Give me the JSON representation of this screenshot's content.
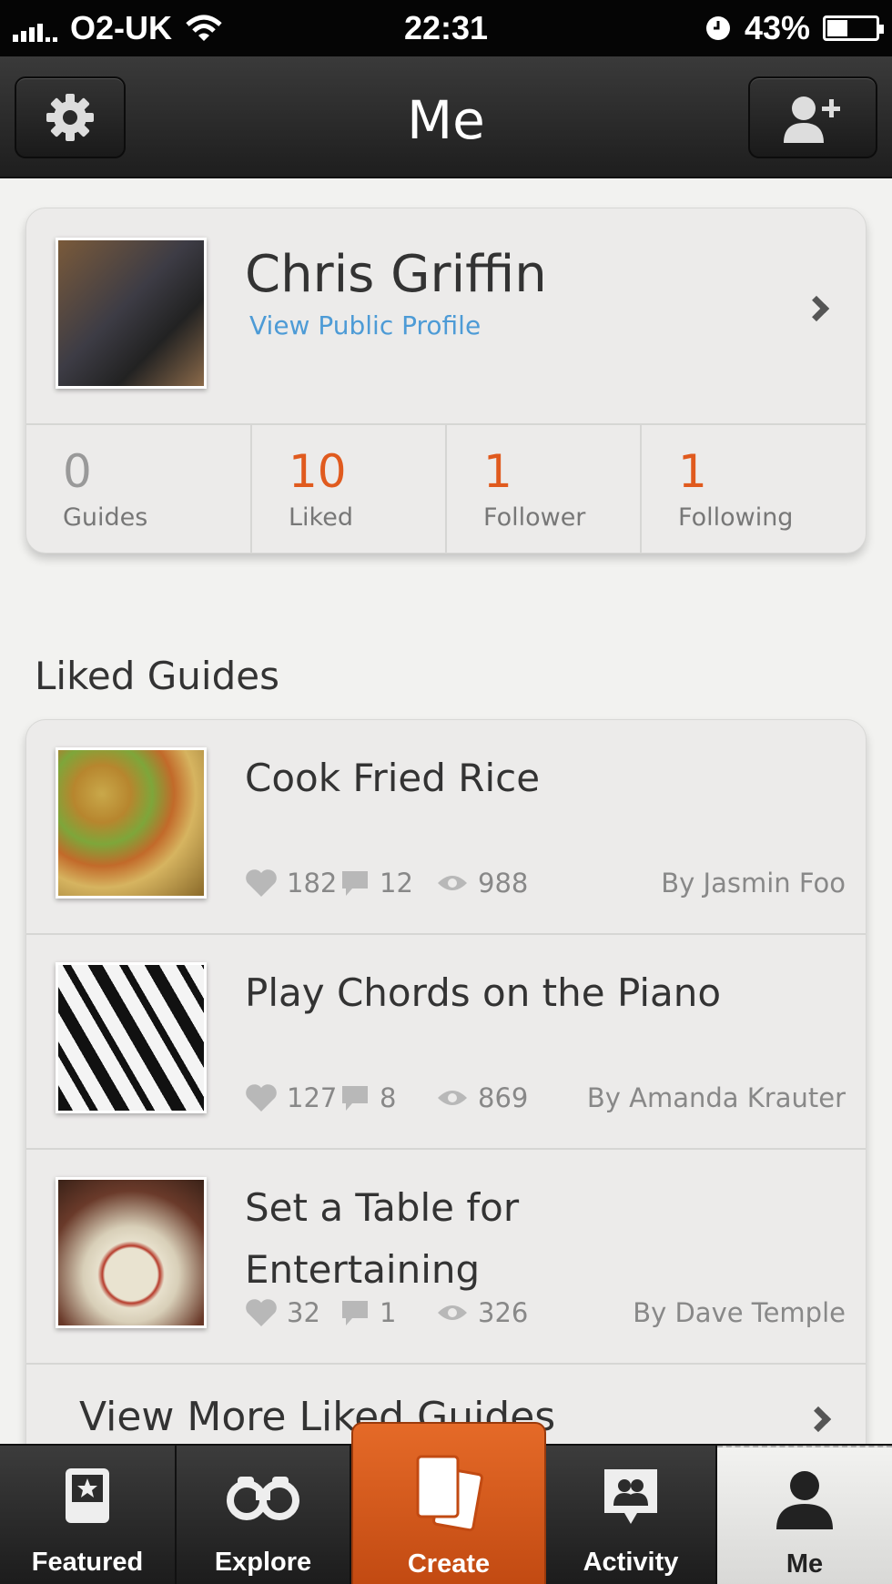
{
  "status_bar": {
    "carrier": "O2-UK",
    "time": "22:31",
    "battery_percent": "43%",
    "battery_level": 0.43,
    "icons": [
      "signal-icon",
      "wifi-icon",
      "alarm-clock-icon",
      "battery-icon"
    ]
  },
  "nav": {
    "title": "Me",
    "left_button_icon": "gear-icon",
    "right_button_icon": "add-friend-icon"
  },
  "profile": {
    "name": "Chris Griffin",
    "link": "View Public Profile",
    "stats": [
      {
        "value": "0",
        "label": "Guides"
      },
      {
        "value": "10",
        "label": "Liked"
      },
      {
        "value": "1",
        "label": "Follower"
      },
      {
        "value": "1",
        "label": "Following"
      }
    ]
  },
  "liked": {
    "section_title": "Liked Guides",
    "guides": [
      {
        "title": "Cook Fried Rice",
        "likes": "182",
        "comments": "12",
        "views": "988",
        "author": "By Jasmin Foo"
      },
      {
        "title": "Play Chords on the Piano",
        "likes": "127",
        "comments": "8",
        "views": "869",
        "author": "By Amanda Krauter"
      },
      {
        "title": "Set a Table for Entertaining",
        "likes": "32",
        "comments": "1",
        "views": "326",
        "author": "By Dave Temple"
      }
    ],
    "view_more": "View More Liked Guides"
  },
  "tabs": [
    {
      "label": "Featured",
      "icon": "featured-icon"
    },
    {
      "label": "Explore",
      "icon": "binoculars-icon"
    },
    {
      "label": "Create",
      "icon": "cards-icon"
    },
    {
      "label": "Activity",
      "icon": "activity-icon"
    },
    {
      "label": "Me",
      "icon": "person-icon"
    }
  ],
  "colors": {
    "accent": "#e05a1e",
    "link": "#4d9bd6",
    "create_tab": "#d9581c"
  }
}
